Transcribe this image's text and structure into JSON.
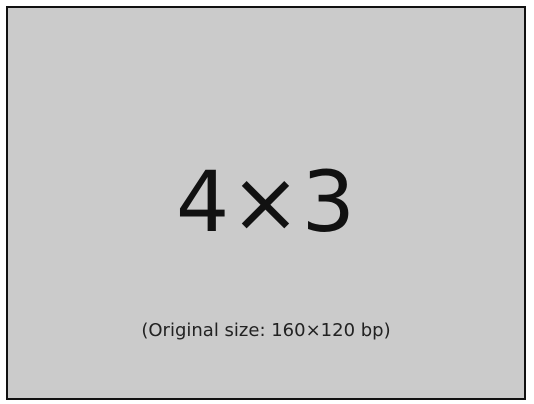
{
  "placeholder": {
    "ratio_text": "4×3",
    "caption": "(Original size: 160×120 bp)",
    "colors": {
      "background": "#cbcbcb",
      "border": "#111111",
      "text": "#111111"
    }
  }
}
